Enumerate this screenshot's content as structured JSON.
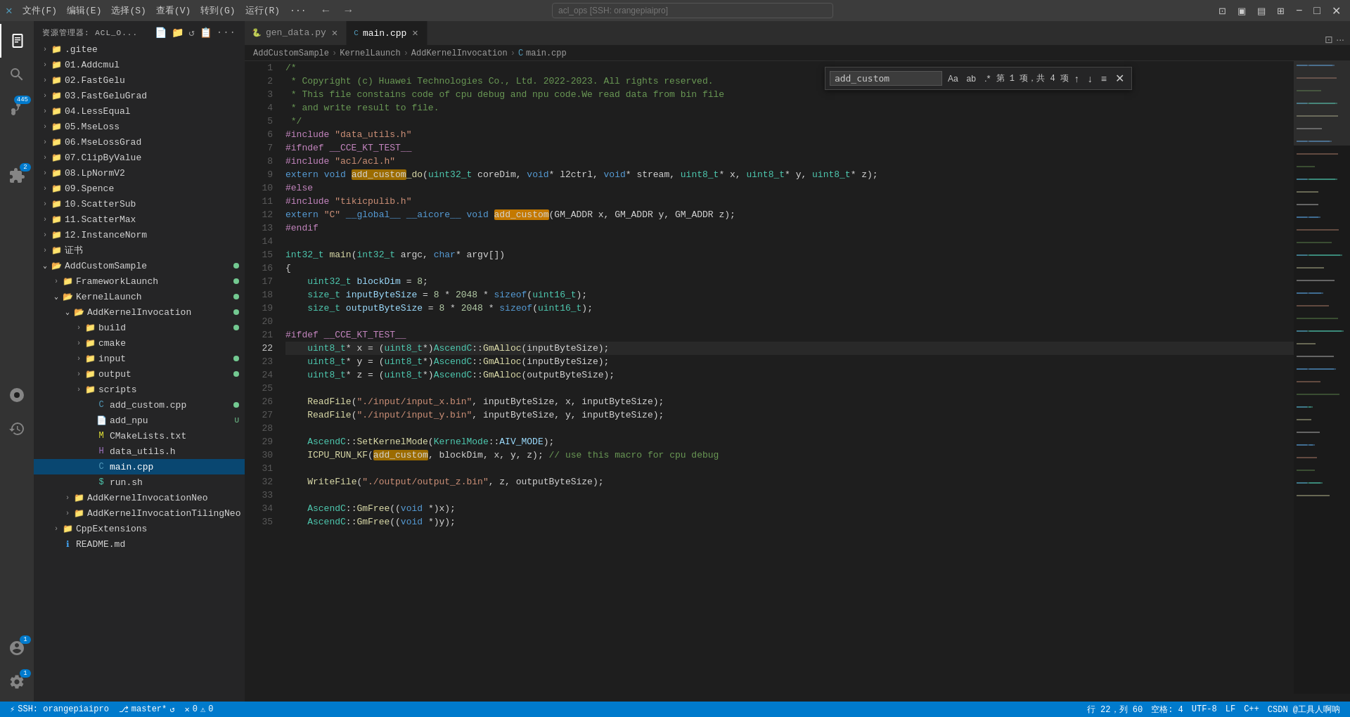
{
  "titlebar": {
    "app_icon": "✕",
    "menu": [
      "文件(F)",
      "编辑(E)",
      "选择(S)",
      "查看(V)",
      "转到(G)",
      "运行(R)",
      "···"
    ],
    "back_btn": "←",
    "forward_btn": "→",
    "search_placeholder": "acl_ops [SSH: orangepiaipro]",
    "split_icon": "⊡",
    "layout1_icon": "▣",
    "layout2_icon": "▤",
    "layout3_icon": "⊞",
    "minimize_icon": "−",
    "maximize_icon": "□",
    "close_icon": "✕"
  },
  "sidebar": {
    "header_title": "资源管理器: ACL_O...",
    "icons": [
      "📄+",
      "📁+",
      "↺",
      "📋",
      "···"
    ],
    "items": [
      {
        "label": ".gitee",
        "indent": 1,
        "type": "folder",
        "chevron": "›"
      },
      {
        "label": "01.Addcmul",
        "indent": 1,
        "type": "folder",
        "chevron": "›"
      },
      {
        "label": "02.FastGelu",
        "indent": 1,
        "type": "folder",
        "chevron": "›"
      },
      {
        "label": "03.FastGeluGrad",
        "indent": 1,
        "type": "folder",
        "chevron": "›"
      },
      {
        "label": "04.LessEqual",
        "indent": 1,
        "type": "folder",
        "chevron": "›"
      },
      {
        "label": "05.MseLoss",
        "indent": 1,
        "type": "folder",
        "chevron": "›"
      },
      {
        "label": "06.MseLossGrad",
        "indent": 1,
        "type": "folder",
        "chevron": "›"
      },
      {
        "label": "07.ClipByValue",
        "indent": 1,
        "type": "folder",
        "chevron": "›"
      },
      {
        "label": "08.LpNormV2",
        "indent": 1,
        "type": "folder",
        "chevron": "›"
      },
      {
        "label": "09.Spence",
        "indent": 1,
        "type": "folder",
        "chevron": "›"
      },
      {
        "label": "10.ScatterSub",
        "indent": 1,
        "type": "folder",
        "chevron": "›"
      },
      {
        "label": "11.ScatterMax",
        "indent": 1,
        "type": "folder",
        "chevron": "›"
      },
      {
        "label": "12.InstanceNorm",
        "indent": 1,
        "type": "folder",
        "chevron": "›"
      },
      {
        "label": "证书",
        "indent": 1,
        "type": "folder",
        "chevron": "›"
      },
      {
        "label": "AddCustomSample",
        "indent": 1,
        "type": "folder_open",
        "chevron": "⌄",
        "dot": "green"
      },
      {
        "label": "FrameworkLaunch",
        "indent": 2,
        "type": "folder",
        "chevron": "›",
        "dot": "green"
      },
      {
        "label": "KernelLaunch",
        "indent": 2,
        "type": "folder_open",
        "chevron": "⌄",
        "dot": "green"
      },
      {
        "label": "AddKernelInvocation",
        "indent": 3,
        "type": "folder_open",
        "chevron": "⌄",
        "dot": "green"
      },
      {
        "label": "build",
        "indent": 4,
        "type": "folder",
        "chevron": "›",
        "dot": "green"
      },
      {
        "label": "cmake",
        "indent": 4,
        "type": "folder",
        "chevron": "›"
      },
      {
        "label": "input",
        "indent": 4,
        "type": "folder",
        "chevron": "›",
        "dot": "green"
      },
      {
        "label": "output",
        "indent": 4,
        "type": "folder",
        "chevron": "›",
        "dot": "green"
      },
      {
        "label": "scripts",
        "indent": 4,
        "type": "folder",
        "chevron": "›"
      },
      {
        "label": "add_custom.cpp",
        "indent": 4,
        "type": "cpp",
        "dot": "green"
      },
      {
        "label": "add_npu",
        "indent": 4,
        "type": "file",
        "dot": "u"
      },
      {
        "label": "CMakeLists.txt",
        "indent": 4,
        "type": "cmake"
      },
      {
        "label": "data_utils.h",
        "indent": 4,
        "type": "h"
      },
      {
        "label": "main.cpp",
        "indent": 4,
        "type": "cpp",
        "selected": true
      },
      {
        "label": "run.sh",
        "indent": 4,
        "type": "sh"
      },
      {
        "label": "AddKernelInvocationNeo",
        "indent": 3,
        "type": "folder",
        "chevron": "›"
      },
      {
        "label": "AddKernelInvocationTilingNeo",
        "indent": 3,
        "type": "folder",
        "chevron": "›"
      },
      {
        "label": "CppExtensions",
        "indent": 2,
        "type": "folder",
        "chevron": "›"
      },
      {
        "label": "README.md",
        "indent": 2,
        "type": "md"
      }
    ]
  },
  "tabs": [
    {
      "label": "gen_data.py",
      "active": false,
      "icon": "py"
    },
    {
      "label": "main.cpp",
      "active": true,
      "icon": "cpp"
    }
  ],
  "breadcrumb": [
    "AddCustomSample",
    "KernelLaunch",
    "AddKernelInvocation",
    "main.cpp"
  ],
  "find": {
    "query": "add_custom",
    "count": "第 1 项，共 4 项",
    "match_case": "Aa",
    "whole_word": "ab",
    "regex": ".*"
  },
  "code_lines": [
    {
      "num": 1,
      "content": "/*"
    },
    {
      "num": 2,
      "content": " * Copyright (c) Huawei Technologies Co., Ltd. 2022-2023. All rights reserved."
    },
    {
      "num": 3,
      "content": " * This file constains code of cpu debug and npu code.We read data from bin file"
    },
    {
      "num": 4,
      "content": " * and write result to file."
    },
    {
      "num": 5,
      "content": " */"
    },
    {
      "num": 6,
      "content": "#include \"data_utils.h\""
    },
    {
      "num": 7,
      "content": "#ifndef __CCE_KT_TEST__"
    },
    {
      "num": 8,
      "content": "#include \"acl/acl.h\""
    },
    {
      "num": 9,
      "content": "extern void add_custom_do(uint32_t coreDim, void* l2ctrl, void* stream, uint8_t* x, uint8_t* y, uint8_t* z);"
    },
    {
      "num": 10,
      "content": "#else"
    },
    {
      "num": 11,
      "content": "#include \"tikicpulib.h\""
    },
    {
      "num": 12,
      "content": "extern \"C\" __global__ __aicore__ void add_custom(GM_ADDR x, GM_ADDR y, GM_ADDR z);"
    },
    {
      "num": 13,
      "content": "#endif"
    },
    {
      "num": 14,
      "content": ""
    },
    {
      "num": 15,
      "content": "int32_t main(int32_t argc, char* argv[])"
    },
    {
      "num": 16,
      "content": "{"
    },
    {
      "num": 17,
      "content": "    uint32_t blockDim = 8;"
    },
    {
      "num": 18,
      "content": "    size_t inputByteSize = 8 * 2048 * sizeof(uint16_t);"
    },
    {
      "num": 19,
      "content": "    size_t outputByteSize = 8 * 2048 * sizeof(uint16_t);"
    },
    {
      "num": 20,
      "content": ""
    },
    {
      "num": 21,
      "content": "#ifdef __CCE_KT_TEST__"
    },
    {
      "num": 22,
      "content": "    uint8_t* x = (uint8_t*)AscendC::GmAlloc(inputByteSize);"
    },
    {
      "num": 23,
      "content": "    uint8_t* y = (uint8_t*)AscendC::GmAlloc(inputByteSize);"
    },
    {
      "num": 24,
      "content": "    uint8_t* z = (uint8_t*)AscendC::GmAlloc(outputByteSize);"
    },
    {
      "num": 25,
      "content": ""
    },
    {
      "num": 26,
      "content": "    ReadFile(\"./input/input_x.bin\", inputByteSize, x, inputByteSize);"
    },
    {
      "num": 27,
      "content": "    ReadFile(\"./input/input_y.bin\", inputByteSize, y, inputByteSize);"
    },
    {
      "num": 28,
      "content": ""
    },
    {
      "num": 29,
      "content": "    AscendC::SetKernelMode(KernelMode::AIV_MODE);"
    },
    {
      "num": 30,
      "content": "    ICPU_RUN_KF(add_custom, blockDim, x, y, z); // use this macro for cpu debug"
    },
    {
      "num": 31,
      "content": ""
    },
    {
      "num": 32,
      "content": "    WriteFile(\"./output/output_z.bin\", z, outputByteSize);"
    },
    {
      "num": 33,
      "content": ""
    },
    {
      "num": 34,
      "content": "    AscendC::GmFree((void *)x);"
    },
    {
      "num": 35,
      "content": "    AscendC::GmFree((void *)y);"
    }
  ],
  "statusbar": {
    "ssh_icon": "🔒",
    "ssh_label": "SSH: orangepiaipro",
    "git_icon": "⎇",
    "git_branch": "master*",
    "sync_icon": "↺",
    "errors": "0",
    "warnings": "0",
    "position": "行 22，列 60",
    "spaces": "空格: 4",
    "encoding": "UTF-8",
    "line_ending": "LF",
    "language": "C++",
    "feedback": "CSDN @工具人啊呐",
    "account_icon": "👤",
    "settings_icon": "⚙",
    "notifications": "1"
  }
}
